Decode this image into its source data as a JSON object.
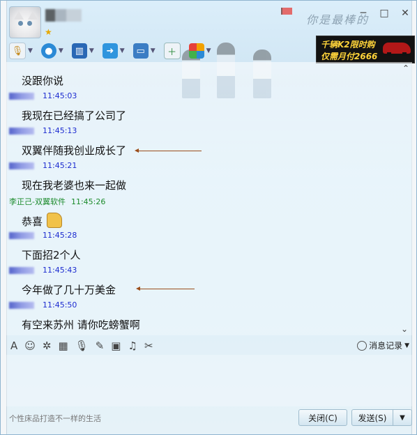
{
  "header": {
    "skin_text": "你是最棒的",
    "controls": {
      "minimize": "─",
      "maximize": "□",
      "close": "✕"
    }
  },
  "toolbar": {
    "items": [
      {
        "icon": "microphone-icon"
      },
      {
        "icon": "webcam-icon"
      },
      {
        "icon": "remote-desktop-icon"
      },
      {
        "icon": "file-transfer-icon"
      },
      {
        "icon": "screen-share-icon"
      },
      {
        "icon": "create-group-icon"
      },
      {
        "icon": "apps-icon"
      }
    ]
  },
  "ad": {
    "line1": "千辆K2限时购",
    "line2": "仅需月付2666"
  },
  "messages": [
    {
      "text": "没跟你说",
      "time": "11:45:03"
    },
    {
      "text": "我现在已经搞了公司了",
      "time": "11:45:13"
    },
    {
      "text": "双翼伴随我创业成长了",
      "time": "11:45:21"
    },
    {
      "text": "现在我老婆也来一起做",
      "sender": "李正己-双翼软件",
      "time": "11:45:26"
    },
    {
      "text": "恭喜",
      "time": "11:45:28"
    },
    {
      "text": "下面招2个人",
      "time": "11:45:43"
    },
    {
      "text": "今年做了几十万美金",
      "time": "11:45:50"
    },
    {
      "text": "有空来苏州 请你吃螃蟹啊"
    }
  ],
  "input_toolbar": {
    "tools": [
      "A",
      "☺",
      "✲",
      "▦",
      "🎙",
      "✎",
      "▣",
      "♫",
      "✂"
    ],
    "history_label": "消息记录"
  },
  "footer": {
    "signature": "个性床品打造不一样的生活",
    "close_button": "关闭(C)",
    "send_button": "发送(S)"
  }
}
